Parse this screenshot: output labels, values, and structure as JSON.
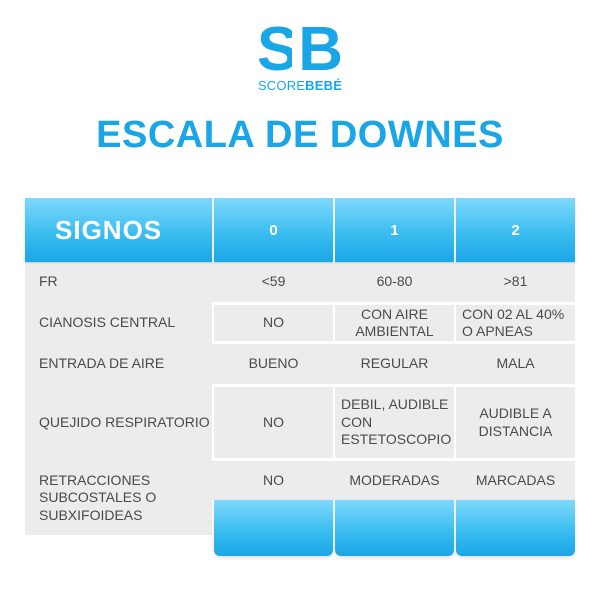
{
  "logo": {
    "mark": "SB",
    "text_light": "SCORE",
    "text_bold": "BEBÉ"
  },
  "title": "ESCALA DE DOWNES",
  "table": {
    "header": {
      "signos": "SIGNOS",
      "col0": "0",
      "col1": "1",
      "col2": "2"
    },
    "rows": [
      {
        "label": "FR",
        "v0": "<59",
        "v1": "60-80",
        "v2": ">81"
      },
      {
        "label": "CIANOSIS CENTRAL",
        "v0": "NO",
        "v1": "CON AIRE AMBIENTAL",
        "v2": "CON 02 AL 40% O APNEAS"
      },
      {
        "label": "ENTRADA DE AIRE",
        "v0": "BUENO",
        "v1": "REGULAR",
        "v2": "MALA"
      },
      {
        "label": "QUEJIDO RESPIRATORIO",
        "v0": "NO",
        "v1": "DEBIL, AUDIBLE CON ESTETOSCOPIO",
        "v2": "AUDIBLE A DISTANCIA"
      },
      {
        "label": "RETRACCIONES SUBCOSTALES O SUBXIFOIDEAS",
        "v0": "NO",
        "v1": "MODERADAS",
        "v2": "MARCADAS"
      }
    ]
  },
  "colors": {
    "brand_blue": "#1aa6e6",
    "light_blue": "#7fd9fb",
    "row_gray": "#ececec",
    "text_gray": "#4a4a4a"
  }
}
